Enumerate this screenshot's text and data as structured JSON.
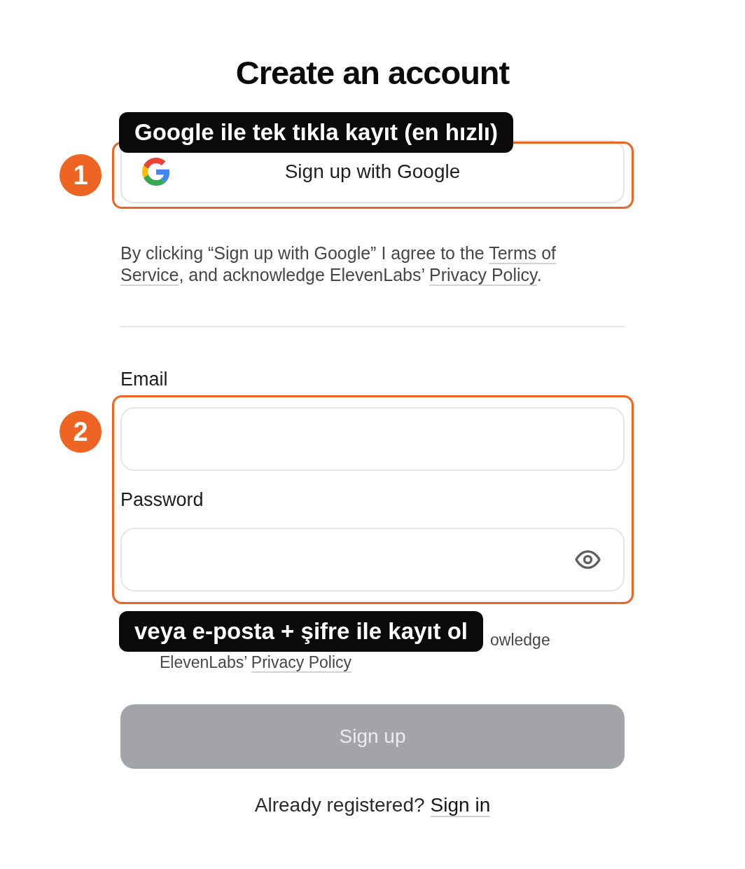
{
  "page": {
    "title": "Create an account"
  },
  "google_signup": {
    "annotation": {
      "number": "1",
      "label": "Google ile tek tıkla kayıt (en hızlı)"
    },
    "button_label": "Sign up with Google",
    "consent": [
      {
        "kind": "text",
        "text": "By clicking “Sign up with Google” I agree to the "
      },
      {
        "kind": "link",
        "text": "Terms of "
      },
      {
        "kind": "link",
        "text": "Service"
      },
      {
        "kind": "text",
        "text": ", and acknowledge ElevenLabs’ "
      },
      {
        "kind": "link",
        "text": "Privacy Policy"
      },
      {
        "kind": "text",
        "text": "."
      }
    ]
  },
  "credentials": {
    "email": {
      "label": "Email"
    },
    "password": {
      "label": "Password"
    },
    "annotation": {
      "number": "2",
      "label": "veya e-posta + şifre ile kayıt ol"
    }
  },
  "consent_partial": [
    [
      {
        "kind": "text",
        "text": "owledge"
      }
    ],
    [
      {
        "kind": "text",
        "text": "ElevenLabs’ "
      },
      {
        "kind": "link",
        "text": "Privacy Policy"
      }
    ]
  ],
  "submit": {
    "label": "Sign up",
    "disabled": true
  },
  "footer": {
    "text": "Already registered?",
    "link": "Sign in"
  }
}
